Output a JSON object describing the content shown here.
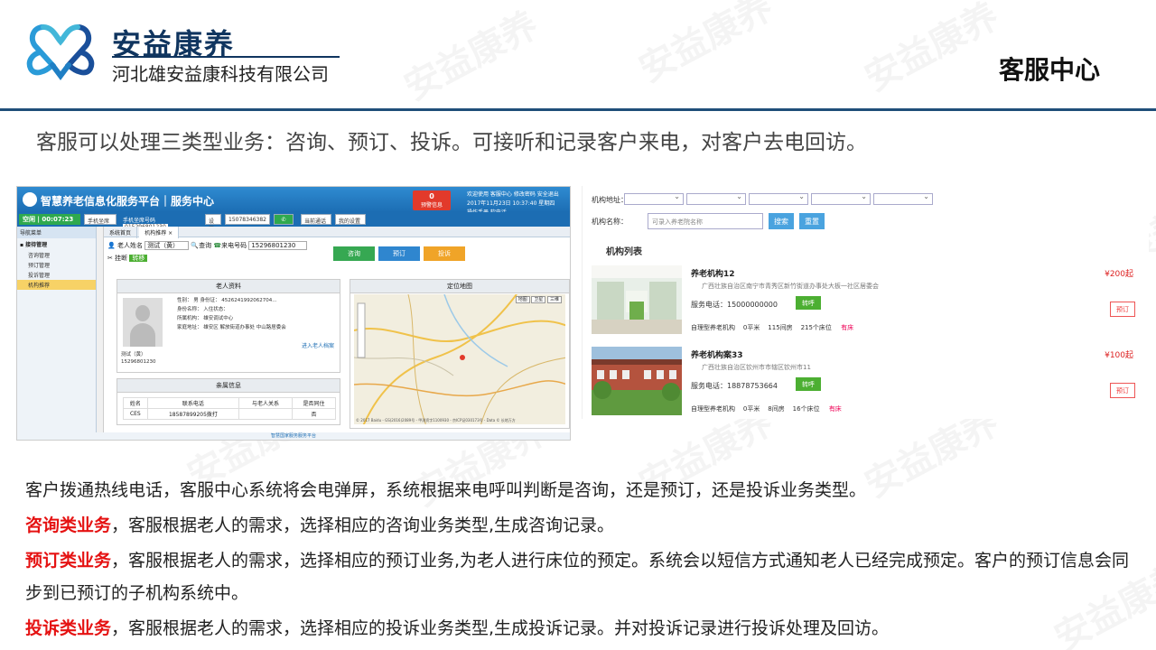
{
  "watermark": "安益康养",
  "brand": {
    "name": "安益康养",
    "company": "河北雄安益康科技有限公司"
  },
  "page_title": "客服中心",
  "intro": "客服可以处理三类型业务：咨询、预订、投诉。可接听和记录客户来电，对客户去电回访。",
  "colors": {
    "accent": "#1f4e79",
    "highlight": "#e51212",
    "app_blue": "#1c6db3"
  },
  "shot1": {
    "app_title": "智慧养老信息化服务平台｜服务中心",
    "warning_count": "0",
    "warning_label": "预警信息",
    "top_right_line1": "欢迎使用 客服中心   修改密码   安全退出",
    "top_right_line2": "2017年11月23日 10:37:40 星期四",
    "top_right_line3": "操作手册        软电话",
    "status": "空闲 | 00:07:23",
    "phone_type": "手机坐席",
    "phone_label": "手机坐席号码",
    "phone_value": "015296801230",
    "set_label": "设置",
    "number_value": "15078346382",
    "current_call": "当前通话",
    "my_settings": "我的设置",
    "sidebar_header": "导航菜单",
    "sidebar_group": "接待管理",
    "sidebar_items": [
      "咨询管理",
      "预订管理",
      "投诉管理",
      "机构推荐"
    ],
    "tab_home": "系统首页",
    "tab_current": "机构推荐 ×",
    "elder_name_label": "老人姓名",
    "elder_name_value": "测试（黄）",
    "query_label": "查询",
    "caller_label": "来电号码",
    "caller_value": "15296801230",
    "hangup_label": "挂断",
    "transfer_label": "转移",
    "btn_consult": "咨询",
    "btn_book": "预订",
    "btn_complain": "投诉",
    "elder_panel_title": "老人资料",
    "elder_display_name": "测试（黄）",
    "elder_display_phone": "15296801230",
    "info_lines": [
      "性别： 男            身份证： 4526241992062704...",
      "身份名称：                    入住状态：",
      "所属机构： 雄安调试中心",
      "家庭地址： 雄安区 解放街道办事处 中山路居委会"
    ],
    "enter_archive": "进入老人档案",
    "family_panel_title": "亲属信息",
    "family_headers": [
      "姓名",
      "联系电话",
      "与老人关系",
      "是否同住"
    ],
    "family_row": [
      "CES",
      "18587899205拨打",
      "",
      "否"
    ],
    "map_title": "定位地图",
    "map_controls": [
      "地图",
      "卫星",
      "三维"
    ],
    "map_copyright": "© 2017 Baidu - GS(2016)2089号 - 甲测资字1100930 - 京ICP证030173号 - Data © 长地万方",
    "footer": "智慧国家服务服务平台"
  },
  "shot2": {
    "org_address_label": "机构地址：",
    "org_name_label": "机构名称：",
    "search_placeholder": "可录入养老院名称",
    "search_btn": "搜索",
    "reset_btn": "重置",
    "list_title": "机构列表",
    "items": [
      {
        "name": "养老机构12",
        "address": "广西壮族自治区南宁市青秀区新竹街道办事处大板一社区居委会",
        "phone": "服务电话：15000000000",
        "transfer": "转呼",
        "type": "自理型养老机构",
        "area": "0平米",
        "rooms": "115间房",
        "beds": "215个床位",
        "free": "有床",
        "price": "¥200起",
        "book": "预订"
      },
      {
        "name": "养老机构案33",
        "address": "广西壮族自治区钦州市市辖区钦州市11",
        "phone": "服务电话：18878753664",
        "transfer": "转呼",
        "type": "自理型养老机构",
        "area": "0平米",
        "rooms": "8间房",
        "beds": "16个床位",
        "free": "有床",
        "price": "¥100起",
        "book": "预订"
      }
    ]
  },
  "body": {
    "p1": "客户拨通热线电话，客服中心系统将会电弹屏，系统根据来电呼叫判断是咨询，还是预订，还是投诉业务类型。",
    "consult_label": "咨询类业务",
    "consult_text": "，客服根据老人的需求，选择相应的咨询业务类型,生成咨询记录。",
    "book_label": "预订类业务",
    "book_text": "，客服根据老人的需求，选择相应的预订业务,为老人进行床位的预定。系统会以短信方式通知老人已经完成预定。客户的预订信息会同步到已预订的子机构系统中。",
    "complain_label": "投诉类业务",
    "complain_text": "，客服根据老人的需求，选择相应的投诉业务类型,生成投诉记录。并对投诉记录进行投诉处理及回访。"
  }
}
